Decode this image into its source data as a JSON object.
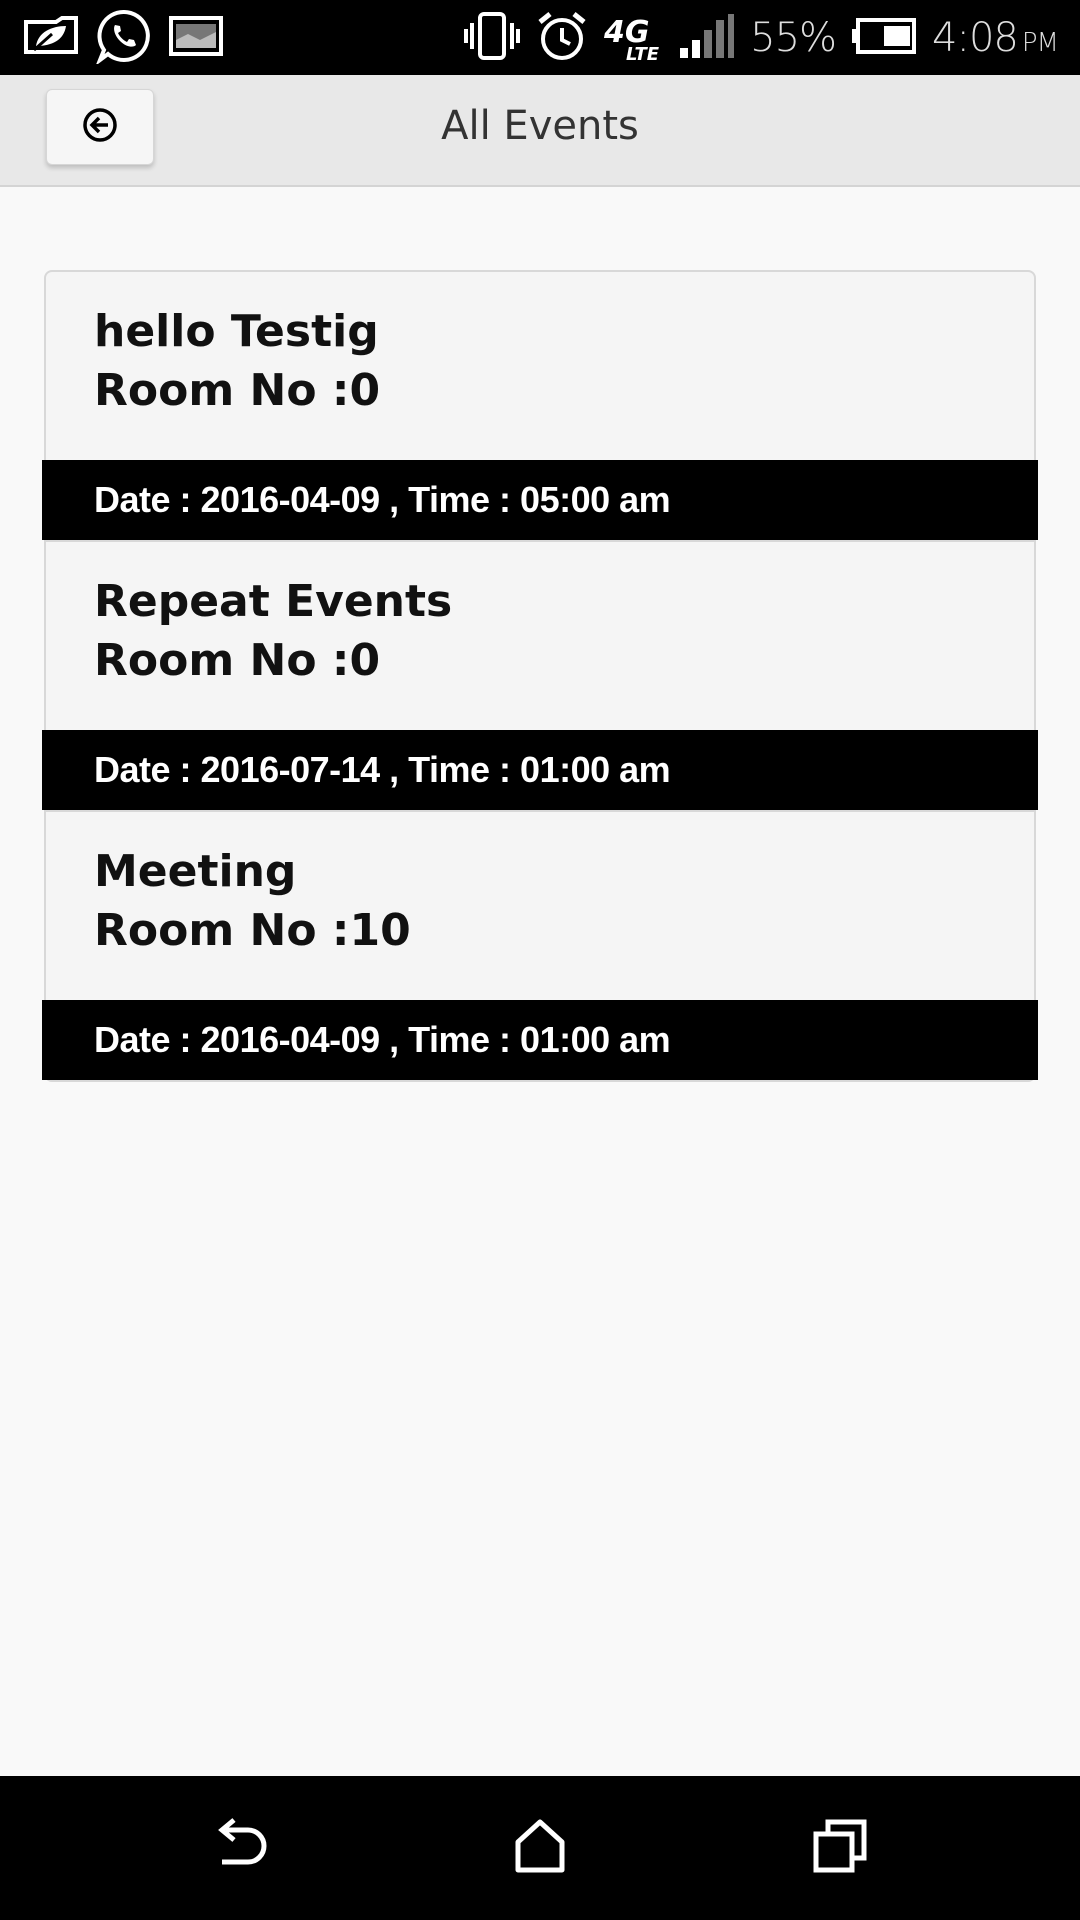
{
  "status_bar": {
    "left_icons": [
      "notification-leaf-icon",
      "whatsapp-icon",
      "image-icon"
    ],
    "right_icons": [
      "vibrate-icon",
      "alarm-icon",
      "4g-lte-icon",
      "signal-icon",
      "battery-icon"
    ],
    "network_label": "4G",
    "network_sub": "LTE",
    "battery_percent": "55%",
    "battery_level": 0.55,
    "time": "4:08",
    "ampm": "PM"
  },
  "header": {
    "title": "All Events",
    "back_icon": "back-arrow-circle-icon"
  },
  "events": [
    {
      "title": "hello Testig",
      "room": "Room No :0",
      "footer": "Date : 2016-04-09 , Time : 05:00 am"
    },
    {
      "title": "Repeat Events",
      "room": "Room No :0",
      "footer": "Date : 2016-07-14 , Time : 01:00 am"
    },
    {
      "title": "Meeting",
      "room": "Room No :10",
      "footer": "Date : 2016-04-09 , Time : 01:00 am"
    }
  ],
  "nav_bar": {
    "buttons": [
      "back-icon",
      "home-icon",
      "recents-icon"
    ]
  }
}
